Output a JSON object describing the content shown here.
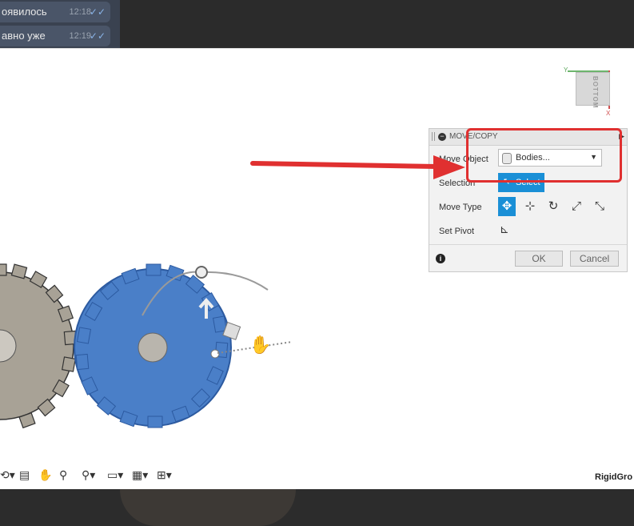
{
  "background_chat": {
    "messages": [
      {
        "text": "оявилось",
        "time": "12:18",
        "check": "✓✓"
      },
      {
        "text": "авно уже",
        "time": "12:19",
        "check": "✓✓"
      }
    ]
  },
  "viewcube": {
    "face_label": "BOTTOM",
    "axis_y": "Y",
    "axis_x": "X"
  },
  "panel": {
    "title": "MOVE/COPY",
    "move_object_label": "Move Object",
    "move_object_value": "Bodies...",
    "selection_label": "Selection",
    "select_button": "Select",
    "move_type_label": "Move Type",
    "set_pivot_label": "Set Pivot",
    "ok_label": "OK",
    "cancel_label": "Cancel"
  },
  "watermark": "RigidGro",
  "colors": {
    "accent": "#1a8fd6",
    "annotation": "#e03030",
    "gear_blue": "#4a7fc8",
    "gear_grey": "#a8a296"
  },
  "icons": [
    "dropdown-arrow-icon",
    "cursor-icon",
    "free-move-icon",
    "translate-icon",
    "rotate-icon",
    "point-to-point-icon",
    "point-to-position-icon",
    "pivot-icon",
    "info-icon",
    "orbit-icon",
    "look-at-icon",
    "pan-icon",
    "zoom-icon",
    "fit-icon",
    "display-settings-icon",
    "grid-icon",
    "viewports-icon"
  ]
}
